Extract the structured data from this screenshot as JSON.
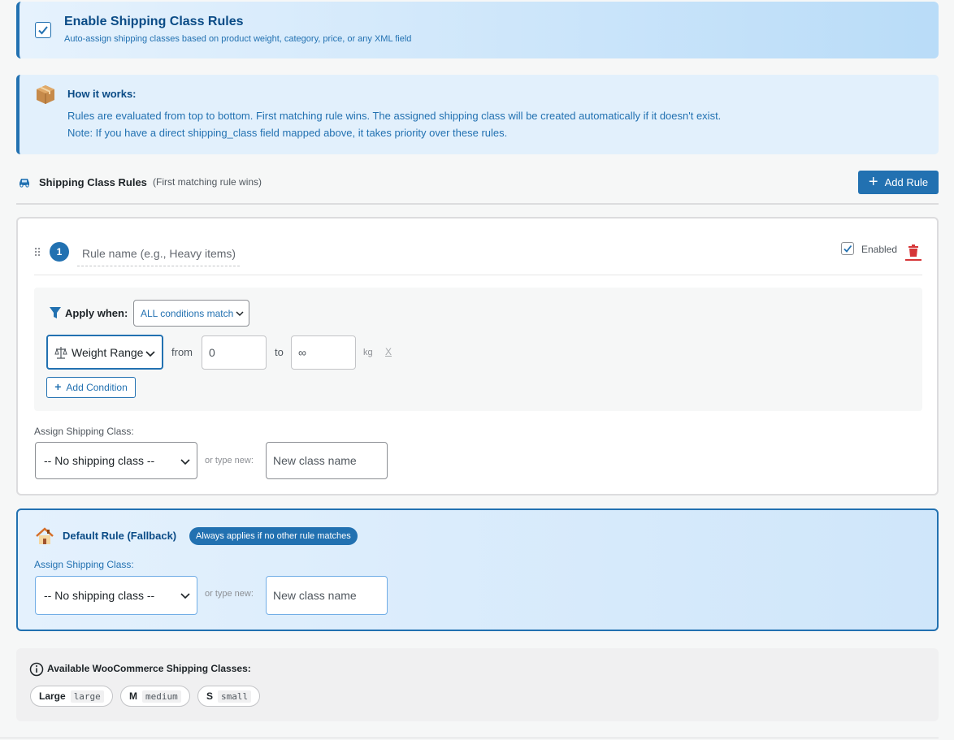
{
  "enable": {
    "checked": true,
    "title": "Enable Shipping Class Rules",
    "subtitle": "Auto-assign shipping classes based on product weight, category, price, or any XML field"
  },
  "info": {
    "title": "How it works:",
    "line1": "Rules are evaluated from top to bottom. First matching rule wins. The assigned shipping class will be created automatically if it doesn't exist.",
    "line2": "Note: If you have a direct shipping_class field mapped above, it takes priority over these rules.",
    "icon": "package-icon"
  },
  "rules_header": {
    "title": "Shipping Class Rules",
    "hint": "(First matching rule wins)",
    "add_rule_label": "Add Rule",
    "icon": "truck-icon"
  },
  "rule": {
    "number": "1",
    "name_placeholder": "Rule name (e.g., Heavy items)",
    "enabled_label": "Enabled",
    "apply_when_label": "Apply when:",
    "match_mode": "ALL conditions match",
    "condition": {
      "type": "Weight Range",
      "from_label": "from",
      "from_value": "0",
      "to_label": "to",
      "to_value": "∞",
      "unit": "kg",
      "remove": "X"
    },
    "add_condition_label": "Add Condition",
    "assign_label": "Assign Shipping Class:",
    "class_value": "-- No shipping class --",
    "or_type_new": "or type new:",
    "new_class_placeholder": "New class name"
  },
  "default_rule": {
    "title": "Default Rule (Fallback)",
    "badge": "Always applies if no other rule matches",
    "assign_label": "Assign Shipping Class:",
    "class_value": "-- No shipping class --",
    "or_type_new": "or type new:",
    "new_class_placeholder": "New class name"
  },
  "available": {
    "title": "Available WooCommerce Shipping Classes:",
    "classes": [
      {
        "name": "Large",
        "slug": "large"
      },
      {
        "name": "M",
        "slug": "medium"
      },
      {
        "name": "S",
        "slug": "small"
      }
    ]
  },
  "colors": {
    "accent": "#2271b1",
    "danger": "#d63638"
  }
}
